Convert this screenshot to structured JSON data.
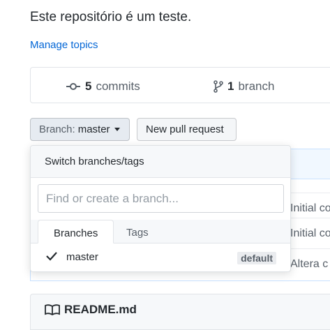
{
  "repo": {
    "description": "Este repositório é um teste.",
    "manage_topics": "Manage topics"
  },
  "summary": {
    "commits_count": "5",
    "commits_label": "commits",
    "branches_count": "1",
    "branches_label": "branch"
  },
  "toolbar": {
    "branch_prefix": "Branch:",
    "branch_value": "master",
    "new_pr": "New pull request"
  },
  "dropdown": {
    "title": "Switch branches/tags",
    "filter_placeholder": "Find or create a branch...",
    "tabs": [
      "Branches",
      "Tags"
    ],
    "branches": [
      {
        "name": "master",
        "badge": "default",
        "selected": true
      }
    ]
  },
  "files_behind": {
    "rows": [
      "Initial co",
      "Initial co",
      "Altera c"
    ]
  },
  "readme": {
    "title": "README.md"
  },
  "colors": {
    "link": "#0366d6",
    "text": "#24292e",
    "muted": "#586069"
  }
}
